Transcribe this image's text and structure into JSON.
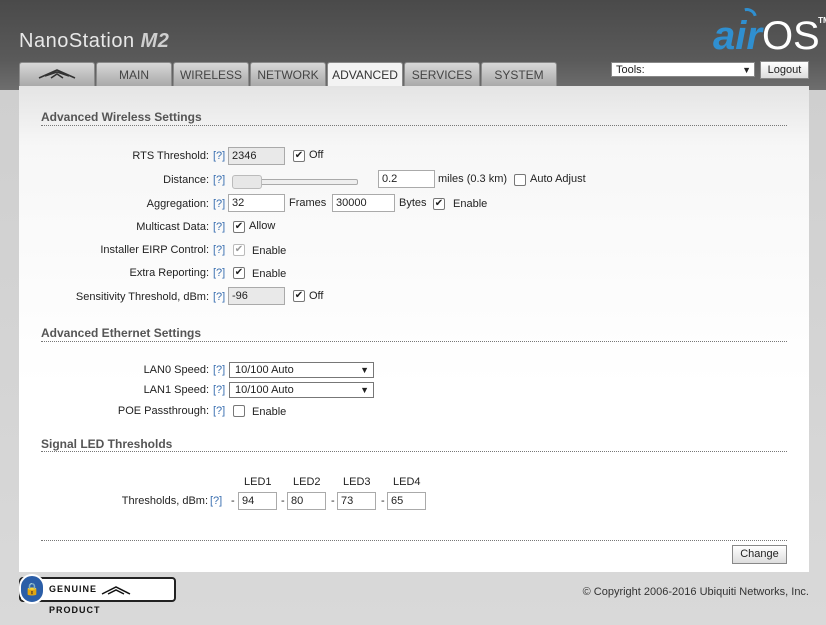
{
  "header": {
    "product": "NanoStation",
    "model": "M2",
    "brand_air": "air",
    "brand_os": "OS",
    "tm": "TM"
  },
  "tabs": [
    {
      "label": "",
      "icon": "ubiquiti-logo-icon"
    },
    {
      "label": "MAIN"
    },
    {
      "label": "WIRELESS"
    },
    {
      "label": "NETWORK"
    },
    {
      "label": "ADVANCED",
      "active": true
    },
    {
      "label": "SERVICES"
    },
    {
      "label": "SYSTEM"
    }
  ],
  "toolbar": {
    "tools_value": "Tools:",
    "logout_label": "Logout"
  },
  "wireless": {
    "title": "Advanced Wireless Settings",
    "rts_label": "RTS Threshold:",
    "rts_value": "2346",
    "rts_off_label": "Off",
    "rts_off_checked": true,
    "distance_label": "Distance:",
    "distance_value": "0.2",
    "distance_unit": "miles (0.3 km)",
    "auto_adjust_label": "Auto Adjust",
    "auto_adjust_checked": false,
    "aggregation_label": "Aggregation:",
    "frames_value": "32",
    "frames_label": "Frames",
    "bytes_value": "30000",
    "bytes_label": "Bytes",
    "aggregation_enable_label": "Enable",
    "aggregation_enable_checked": true,
    "multicast_label": "Multicast Data:",
    "multicast_allow_label": "Allow",
    "multicast_checked": true,
    "eirp_label": "Installer EIRP Control:",
    "eirp_enable_label": "Enable",
    "eirp_checked": true,
    "extra_label": "Extra Reporting:",
    "extra_enable_label": "Enable",
    "extra_checked": true,
    "sensitivity_label": "Sensitivity Threshold, dBm:",
    "sensitivity_value": "-96",
    "sensitivity_off_label": "Off",
    "sensitivity_off_checked": true
  },
  "help": "[?]",
  "ethernet": {
    "title": "Advanced Ethernet Settings",
    "lan0_label": "LAN0 Speed:",
    "lan0_value": "10/100 Auto",
    "lan1_label": "LAN1 Speed:",
    "lan1_value": "10/100 Auto",
    "poe_label": "POE Passthrough:",
    "poe_enable_label": "Enable",
    "poe_checked": false
  },
  "led": {
    "title": "Signal LED Thresholds",
    "headers": [
      "LED1",
      "LED2",
      "LED3",
      "LED4"
    ],
    "label": "Thresholds, dBm:",
    "values": [
      "94",
      "80",
      "73",
      "65"
    ],
    "dash": "-"
  },
  "change_label": "Change",
  "footer": {
    "genuine": "GENUINE",
    "product": "PRODUCT",
    "copyright": "© Copyright 2006-2016 Ubiquiti Networks, Inc."
  }
}
